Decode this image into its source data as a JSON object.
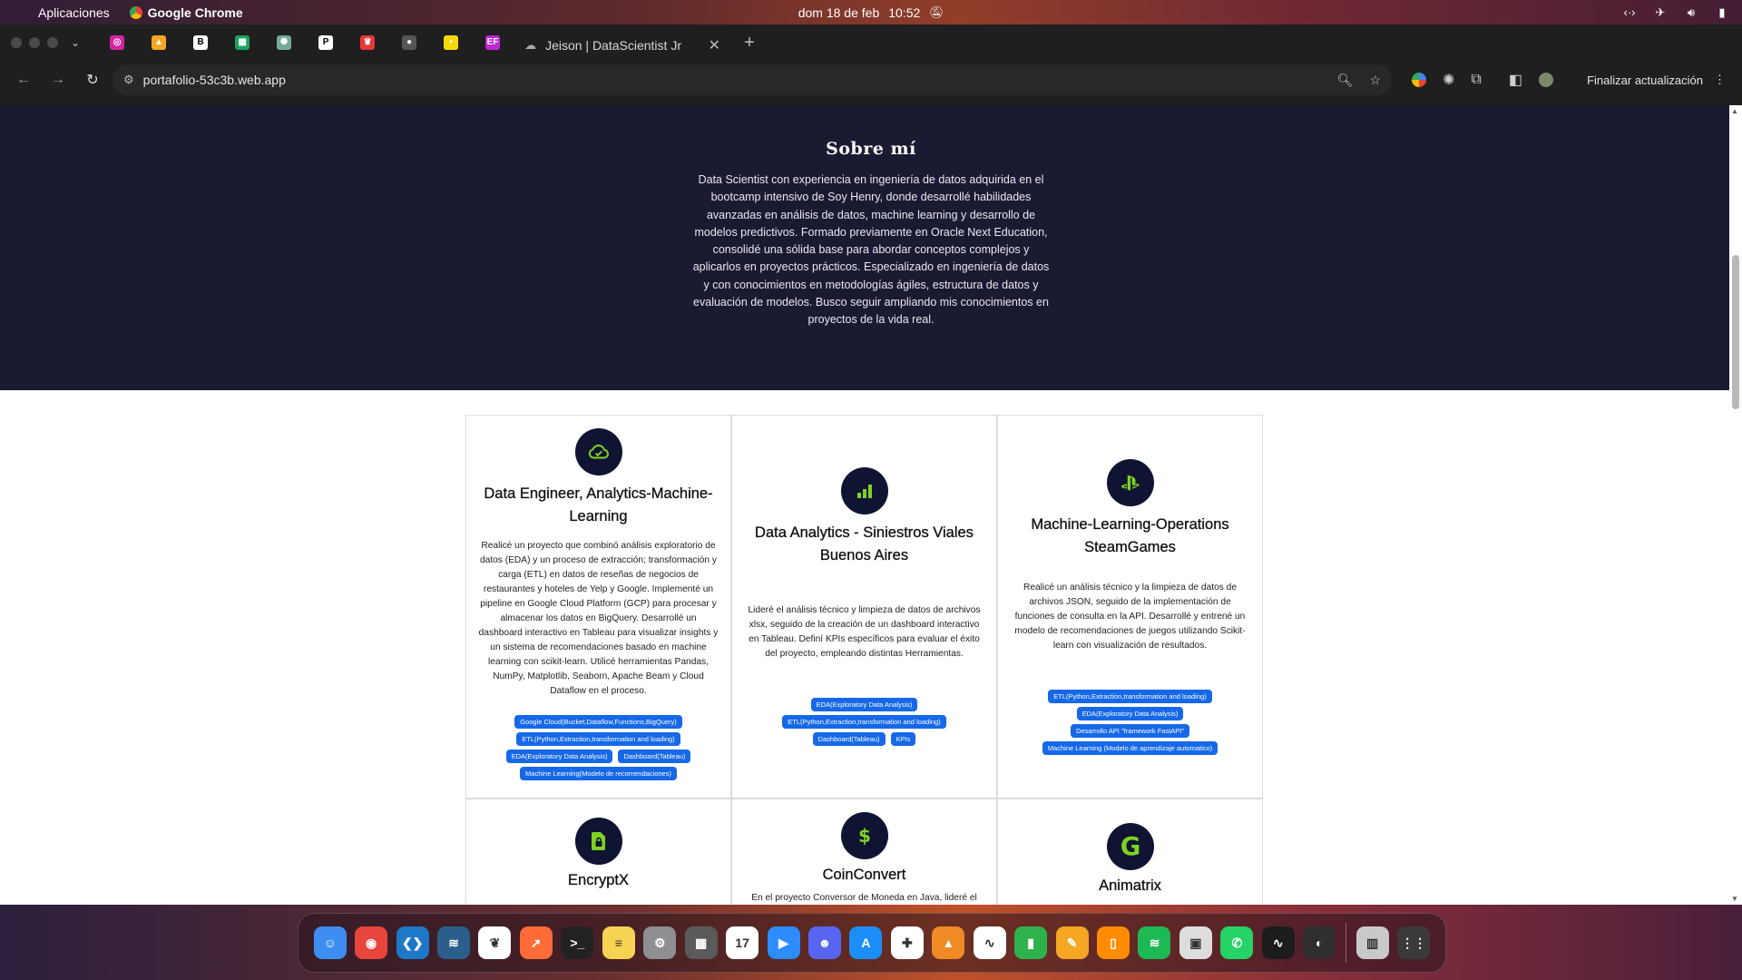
{
  "menubar": {
    "app_menu": "Aplicaciones",
    "app_name": "Google Chrome",
    "date": "dom 18 de feb",
    "time": "10:52"
  },
  "tabs": {
    "active_title": "Jeison | DataScientist Jr",
    "pinned": [
      {
        "icon": "instagram-icon",
        "color": "#d6249f",
        "glyph": "◎"
      },
      {
        "icon": "firebase-icon",
        "color": "#f5a623",
        "glyph": "▲"
      },
      {
        "icon": "behance-icon",
        "color": "#ffffff",
        "glyph": "B"
      },
      {
        "icon": "sheets-icon",
        "color": "#1aa260",
        "glyph": "▦"
      },
      {
        "icon": "chatgpt-icon",
        "color": "#74aa9c",
        "glyph": "✺"
      },
      {
        "icon": "pexels-icon",
        "color": "#ffffff",
        "glyph": "P"
      },
      {
        "icon": "crown-icon",
        "color": "#e53935",
        "glyph": "♛"
      },
      {
        "icon": "github-icon",
        "color": "#555555",
        "glyph": "●"
      },
      {
        "icon": "grid-app-icon",
        "color": "#f5d90a",
        "glyph": "▪"
      },
      {
        "icon": "ef-icon",
        "color": "#c026d3",
        "glyph": "EF"
      }
    ]
  },
  "toolbar": {
    "url": "portafolio-53c3b.web.app",
    "update_label": "Finalizar actualización"
  },
  "about": {
    "title": "Sobre mí",
    "body": "Data Scientist con experiencia en ingeniería de datos adquirida en el bootcamp intensivo de Soy Henry, donde desarrollé habilidades avanzadas en análisis de datos, machine learning y desarrollo de modelos predictivos. Formado previamente en Oracle Next Education, consolidé una sólida base para abordar conceptos complejos y aplicarlos en proyectos prácticos. Especializado en ingeniería de datos y con conocimientos en metodologías ágiles, estructura de datos y evaluación de modelos. Busco seguir ampliando mis conocimientos en proyectos de la vida real."
  },
  "projects": [
    {
      "icon": "cloud-check-icon",
      "title": "Data Engineer, Analytics-Machine-Learning",
      "description": "Realicé un proyecto que combinó análisis exploratorio de datos (EDA) y un proceso de extracción; transformación y carga (ETL) en datos de reseñas de negocios de restaurantes y hoteles de Yelp y Google. Implementé un pipeline en Google Cloud Platform (GCP) para procesar y almacenar los datos en BigQuery. Desarrollé un dashboard interactivo en Tableau para visualizar insights y un sistema de recomendaciones basado en machine learning con scikit-learn. Utilicé herramientas Pandas, NumPy, Matplotlib, Seaborn, Apache Beam y Cloud Dataflow en el proceso.",
      "tags": [
        "Google Cloud(Bucket,Dataflow,Functions,BigQuery)",
        "ETL(Python,Extraction,transformation and loading)",
        "EDA(Exploratory Data Analysis)",
        "Dashboard(Tableau)",
        "Machine Learning(Modelo de recomendaciones)"
      ]
    },
    {
      "icon": "bar-chart-icon",
      "title": "Data Analytics - Siniestros Viales Buenos Aires",
      "description": "Lideré el análisis técnico y limpieza de datos de archivos xlsx, seguido de la creación de un dashboard interactivo en Tableau. Definí KPIs específicos para evaluar el éxito del proyecto, empleando distintas Herramientas.",
      "tags": [
        "EDA(Exploratory Data Analysis)",
        "ETL(Python,Extraction,transformation and loading)",
        "Dashboard(Tableau)",
        "KPIs"
      ]
    },
    {
      "icon": "playstation-icon",
      "title": "Machine-Learning-Operations SteamGames",
      "description": "Realicé un análisis técnico y la limpieza de datos de archivos JSON, seguido de la implementación de funciones de consulta en la API. Desarrollé y entrené un modelo de recomendaciones de juegos utilizando Scikit-learn con visualización de resultados.",
      "tags": [
        "ETL(Python,Extraction,transformation and loading)",
        "EDA(Exploratory Data Analysis)",
        "Desarrollo API \"framework FastAPI\"",
        "Machine Learning (Modelo de aprendizaje automatico)"
      ]
    }
  ],
  "projects_row2": [
    {
      "icon": "file-lock-icon",
      "title": "EncryptX",
      "description": ""
    },
    {
      "icon": "dollar-icon",
      "title": "CoinConvert",
      "description": "En el proyecto Conversor de Moneda en Java, lideré el"
    },
    {
      "icon": "g-logo-icon",
      "title": "Animatrix",
      "description": ""
    }
  ],
  "dock": [
    {
      "name": "finder-icon",
      "color": "#3d8ef0",
      "glyph": "☺"
    },
    {
      "name": "chrome-icon",
      "color": "#e8453c",
      "glyph": "◉"
    },
    {
      "name": "vscode-icon",
      "color": "#1e78c8",
      "glyph": "❮❯"
    },
    {
      "name": "mysql-workbench-icon",
      "color": "#2b5e8c",
      "glyph": "≋"
    },
    {
      "name": "mongodb-icon",
      "color": "#ffffff",
      "glyph": "❦"
    },
    {
      "name": "postman-icon",
      "color": "#ff6c37",
      "glyph": "➚"
    },
    {
      "name": "terminal-icon",
      "color": "#222222",
      "glyph": ">_"
    },
    {
      "name": "notes-icon",
      "color": "#f7d354",
      "glyph": "≡"
    },
    {
      "name": "system-settings-icon",
      "color": "#8e8e93",
      "glyph": "⚙"
    },
    {
      "name": "calculator-icon",
      "color": "#5a5a5a",
      "glyph": "▦"
    },
    {
      "name": "calendar-icon",
      "color": "#ffffff",
      "glyph": "17"
    },
    {
      "name": "zoom-icon",
      "color": "#2d8cff",
      "glyph": "▶"
    },
    {
      "name": "discord-icon",
      "color": "#5865f2",
      "glyph": "☻"
    },
    {
      "name": "app-store-icon",
      "color": "#1c8ef9",
      "glyph": "A"
    },
    {
      "name": "slack-icon",
      "color": "#ffffff",
      "glyph": "✚"
    },
    {
      "name": "vlc-icon",
      "color": "#f08a24",
      "glyph": "▲"
    },
    {
      "name": "freeform-icon",
      "color": "#ffffff",
      "glyph": "∿"
    },
    {
      "name": "numbers-icon",
      "color": "#2fb24c",
      "glyph": "▮"
    },
    {
      "name": "pages-icon",
      "color": "#f5a623",
      "glyph": "✎"
    },
    {
      "name": "books-icon",
      "color": "#ff8c00",
      "glyph": "▯"
    },
    {
      "name": "spotify-icon",
      "color": "#1db954",
      "glyph": "≋"
    },
    {
      "name": "ios-app-installer-icon",
      "color": "#dddddd",
      "glyph": "▣"
    },
    {
      "name": "whatsapp-icon",
      "color": "#25d366",
      "glyph": "✆"
    },
    {
      "name": "activity-monitor-icon",
      "color": "#1c1c1c",
      "glyph": "∿"
    },
    {
      "name": "obs-icon",
      "color": "#302e31",
      "glyph": "◐"
    },
    {
      "name": "trash-icon",
      "color": "#c9c9c9",
      "glyph": "▥"
    },
    {
      "name": "launchpad-icon",
      "color": "#3a3a3a",
      "glyph": "⋮⋮"
    }
  ]
}
